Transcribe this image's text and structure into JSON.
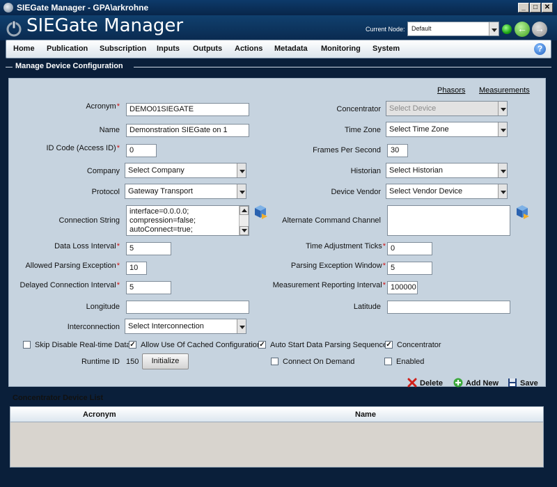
{
  "window": {
    "title": "SIEGate Manager - GPA\\arkrohne"
  },
  "header": {
    "app_title": "SIEGate Manager",
    "current_node_label": "Current Node:",
    "current_node_value": "Default"
  },
  "menu": [
    "Home",
    "Publication",
    "Subscription",
    "Inputs",
    "Outputs",
    "Actions",
    "Metadata",
    "Monitoring",
    "System"
  ],
  "section": {
    "title": "Manage Device Configuration"
  },
  "links": {
    "phasors": "Phasors",
    "measurements": "Measurements"
  },
  "form": {
    "acronym": {
      "label": "Acronym",
      "value": "DEMO01SIEGATE"
    },
    "name": {
      "label": "Name",
      "value": "Demonstration SIEGate on 1"
    },
    "id_code": {
      "label": "ID Code (Access ID)",
      "value": "0"
    },
    "company": {
      "label": "Company",
      "value": "Select Company"
    },
    "protocol": {
      "label": "Protocol",
      "value": "Gateway Transport"
    },
    "connection_string": {
      "label": "Connection String",
      "lines": [
        "interface=0.0.0.0;",
        "compression=false;",
        "autoConnect=true;"
      ]
    },
    "data_loss_interval": {
      "label": "Data Loss Interval",
      "value": "5"
    },
    "allowed_parsing_exception": {
      "label": "Allowed Parsing Exception",
      "value": "10"
    },
    "delayed_connection_interval": {
      "label": "Delayed Connection Interval",
      "value": "5"
    },
    "longitude": {
      "label": "Longitude",
      "value": ""
    },
    "interconnection": {
      "label": "Interconnection",
      "value": "Select Interconnection"
    },
    "concentrator": {
      "label": "Concentrator",
      "value": "Select Device"
    },
    "time_zone": {
      "label": "Time Zone",
      "value": "Select Time Zone"
    },
    "frames_per_second": {
      "label": "Frames Per Second",
      "value": "30"
    },
    "historian": {
      "label": "Historian",
      "value": "Select Historian"
    },
    "device_vendor": {
      "label": "Device Vendor",
      "value": "Select Vendor Device"
    },
    "alternate_command_channel": {
      "label": "Alternate Command Channel",
      "value": ""
    },
    "time_adjustment_ticks": {
      "label": "Time Adjustment Ticks",
      "value": "0"
    },
    "parsing_exception_window": {
      "label": "Parsing Exception Window",
      "value": "5"
    },
    "measurement_reporting_interval": {
      "label": "Measurement Reporting Interval",
      "value": "100000"
    },
    "latitude": {
      "label": "Latitude",
      "value": ""
    }
  },
  "checkboxes": {
    "skip_disable": {
      "label": "Skip Disable Real-time Data",
      "checked": false
    },
    "allow_cached": {
      "label": "Allow Use Of Cached Configuration",
      "checked": true
    },
    "auto_start": {
      "label": "Auto Start Data Parsing Sequence",
      "checked": true
    },
    "concentrator": {
      "label": "Concentrator",
      "checked": true
    },
    "connect_on_demand": {
      "label": "Connect On Demand",
      "checked": false
    },
    "enabled": {
      "label": "Enabled",
      "checked": false
    }
  },
  "runtime": {
    "label": "Runtime ID",
    "value": "150",
    "button": "Initialize"
  },
  "actions": {
    "delete": "Delete",
    "add_new": "Add New",
    "save": "Save"
  },
  "list": {
    "title": "Concentrator Device List",
    "columns": [
      "Acronym",
      "Name"
    ]
  },
  "colors": {
    "accent_blue": "#10406e",
    "panel": "#c6d3df",
    "required": "#d01010"
  }
}
